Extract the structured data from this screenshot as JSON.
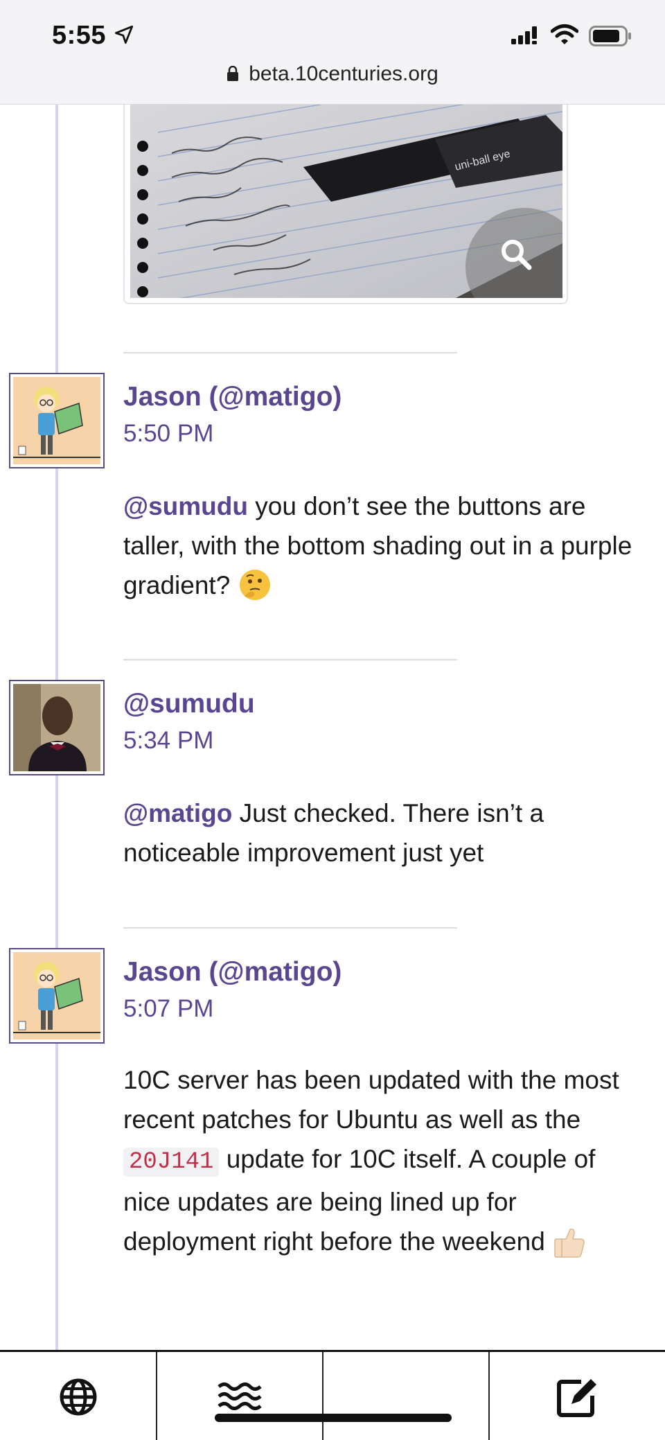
{
  "status_bar": {
    "time": "5:55",
    "url": "beta.10centuries.org"
  },
  "colors": {
    "accent": "#5a4690",
    "timeline_line": "#d6d4ee",
    "code_text": "#c0304a"
  },
  "posts": [
    {
      "author": "Jason (@matigo)",
      "time": "5:50 PM",
      "mention": "@sumudu",
      "text": " you don’t see the buttons are taller, with the bottom shading out in a purple gradient? ",
      "emoji": "thinking-face"
    },
    {
      "author": "@sumudu",
      "time": "5:34 PM",
      "mention": "@matigo",
      "text": " Just checked. There isn’t a noticeable improvement just yet"
    },
    {
      "author": "Jason (@matigo)",
      "time": "5:07 PM",
      "text_before": "10C server has been updated with the most recent patches for Ubuntu as well as the ",
      "code": "20J141",
      "text_after": " update for 10C itself. A couple of nice updates are being lined up for deployment right before the weekend ",
      "emoji": "thumbs-up"
    }
  ],
  "toolbar": {
    "items": [
      "globe-icon",
      "stream-waves-icon",
      "blank",
      "compose-icon"
    ]
  }
}
